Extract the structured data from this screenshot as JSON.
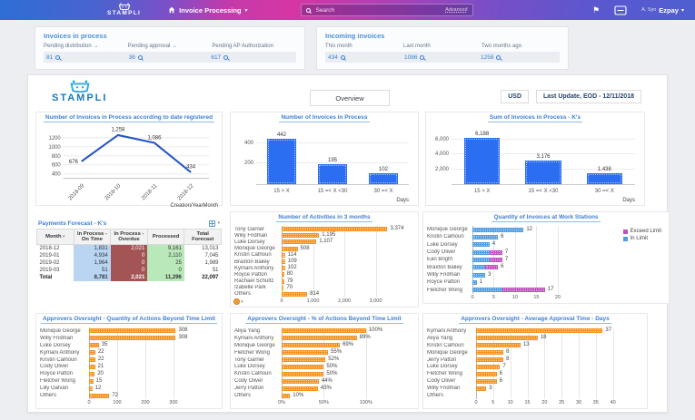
{
  "topbar": {
    "brand": "STAMPLI",
    "nav": {
      "label": "Invoice Processing"
    },
    "search": {
      "placeholder": "Search",
      "advanced": "Advanced"
    },
    "user": {
      "prefix": "A. Syn",
      "name": "Ezpay"
    }
  },
  "summary_cards": [
    {
      "title": "Invoices in process",
      "stats": [
        {
          "label": "Pending distribution →",
          "value": "81"
        },
        {
          "label": "Pending approval →",
          "value": "36"
        },
        {
          "label": "Pending AP Authorization",
          "value": "617"
        }
      ]
    },
    {
      "title": "Incoming invoices",
      "stats": [
        {
          "label": "This month",
          "value": "434"
        },
        {
          "label": "Last month",
          "value": "1086"
        },
        {
          "label": "Two months ago",
          "value": "1258"
        }
      ]
    }
  ],
  "dashboard": {
    "brand": "STAMPLI",
    "tab": "Overview",
    "currency": "USD",
    "last_update": "Last Update, EOD - 12/11/2018"
  },
  "colors": {
    "bar_blue": "#2b6ef2",
    "bar_orange": "#f5921e",
    "line_blue": "#2456c2",
    "in_limit_blue": "#4e9de2",
    "exceed_magenta": "#c24fc0",
    "title_blue": "#3f80d5",
    "topbar_pink": "#d636a4",
    "topbar_blue": "#2e6ed5"
  },
  "chart_data": [
    {
      "type": "line",
      "title": "Number of Invoices in Process according to date registered",
      "x": [
        "2018-09",
        "2018-10",
        "2018-11",
        "2018-12"
      ],
      "values": [
        676,
        1258,
        1086,
        434
      ],
      "labels": [
        "676",
        "1,258",
        "1,086",
        "434"
      ],
      "xlabel": "Creation/YearMonth",
      "yticks": [
        400,
        600,
        800,
        1000,
        1200
      ],
      "ylim": [
        300,
        1350
      ],
      "color": "#2456c2"
    },
    {
      "type": "bar",
      "title": "Number of Invoices in Process",
      "categories": [
        "15 > X",
        "15 =< X <30",
        "30 =< X"
      ],
      "values": [
        442,
        195,
        102
      ],
      "labels": [
        "442",
        "195",
        "102"
      ],
      "xlabel": "Days",
      "yticks": [
        200,
        400
      ],
      "ytick_labels": [
        "200",
        "400"
      ],
      "ylim": [
        0,
        520
      ],
      "color": "#2b6ef2"
    },
    {
      "type": "bar",
      "title": "Sum of Invoices in Process - K's",
      "categories": [
        "15 > X",
        "15 =< X <30",
        "30 =< X"
      ],
      "values": [
        6188,
        3176,
        1438
      ],
      "labels": [
        "6,188",
        "3,176",
        "1,438"
      ],
      "xlabel": "Days",
      "yticks": [
        2000,
        4000,
        6000
      ],
      "ytick_labels": [
        "2,000",
        "4,000",
        "6,000"
      ],
      "ylim": [
        0,
        7200
      ],
      "color": "#2b6ef2"
    },
    {
      "type": "table",
      "title": "Payments Forecast - K's",
      "columns": [
        "Month",
        "In Process - On Time",
        "In Process - Overdue",
        "Processed",
        "Total Forecast"
      ],
      "rows": [
        [
          "2018-12",
          "1,831",
          "2,021",
          "9,161",
          "13,013"
        ],
        [
          "2019-01",
          "4,934",
          "0",
          "2,110",
          "7,045"
        ],
        [
          "2019-02",
          "1,964",
          "0",
          "25",
          "1,989"
        ],
        [
          "2019-03",
          "51",
          "0",
          "0",
          "51"
        ],
        [
          "Total",
          "8,781",
          "2,021",
          "11,296",
          "22,097"
        ]
      ],
      "column_colors": [
        "",
        "#b9d5f2",
        "#a35555",
        "#b9e8ba",
        ""
      ],
      "column_text": [
        "",
        "#333",
        "#fff",
        "#333",
        ""
      ]
    },
    {
      "type": "hbar",
      "title": "Number of Activities in 3 months",
      "categories": [
        "Tony Garner",
        "Willy Fridman",
        "Luke Dorsey",
        "Monique George",
        "Kristin Calhoun",
        "Braxton Bailey",
        "Kymani Anthony",
        "Royce Patton",
        "Rachael Schultz",
        "Izabelle Park",
        "Others"
      ],
      "values": [
        3374,
        1195,
        1107,
        508,
        114,
        109,
        102,
        80,
        79,
        70,
        814
      ],
      "labels": [
        "3,374",
        "1,195",
        "1,107",
        "508",
        "114",
        "109",
        "102",
        "80",
        "79",
        "70",
        "814"
      ],
      "xticks": [
        0,
        1000,
        2000,
        3000
      ],
      "xtick_labels": [
        "0",
        "1,000",
        "2,000",
        "3,000"
      ],
      "xlim": [
        0,
        3650
      ],
      "label_w": 56,
      "rpad": 24,
      "color": "#f5921e"
    },
    {
      "type": "hbar-stacked",
      "title": "Quantity of Invoices at Work Stations",
      "categories": [
        "Monique George",
        "Kristin Calhoun",
        "Luke Dorsey",
        "Cody Oliver",
        "Ean Bright",
        "Braxton Bailey",
        "Willy Fridman",
        "Royce Patton",
        "Fletcher Wong"
      ],
      "series": [
        {
          "name": "In Limit",
          "color": "#4e9de2",
          "values": [
            12,
            6,
            4,
            4,
            4,
            3,
            3,
            1,
            7
          ]
        },
        {
          "name": "Exceed Limit",
          "color": "#c24fc0",
          "values": [
            0,
            0,
            0,
            3,
            3,
            3,
            0,
            0,
            10
          ]
        }
      ],
      "totals": [
        "12",
        "6",
        "4",
        "7",
        "7",
        "6",
        "3",
        "1",
        "17"
      ],
      "legend": [
        "Exceed Limit",
        "In Limit"
      ],
      "legend_colors": [
        "#c24fc0",
        "#4e9de2"
      ],
      "legend_pos": "top-right",
      "xticks": [
        0,
        5,
        10,
        15,
        20
      ],
      "xtick_labels": [
        "0",
        "5",
        "10",
        "15",
        "20"
      ],
      "xlim": [
        0,
        23
      ],
      "label_w": 54,
      "rpad": 108
    },
    {
      "type": "hbar",
      "title": "Approvers Oversight - Quantity of Actions Beyond Time Limit",
      "categories": [
        "Monique George",
        "Willy Fridman",
        "Luke Dorsey",
        "Kymani Anthony",
        "Kristin Calhoun",
        "Cody Oliver",
        "Royce Patton",
        "Fletcher Wong",
        "Lilly Galvan",
        "Others"
      ],
      "values": [
        308,
        308,
        35,
        22,
        22,
        21,
        20,
        15,
        12,
        72
      ],
      "labels": [
        "308",
        "308",
        "35",
        "22",
        "22",
        "21",
        "20",
        "15",
        "12",
        "72"
      ],
      "xticks": [
        0,
        100,
        200,
        300
      ],
      "xtick_labels": [
        "0",
        "100",
        "200",
        "300"
      ],
      "xlim": [
        0,
        400
      ],
      "label_w": 58,
      "rpad": 22,
      "color": "#f5921e"
    },
    {
      "type": "hbar",
      "title": "Approvers Oversight - % of Actions Beyond Time Limit",
      "categories": [
        "Aliya Yang",
        "Kymani Anthony",
        "Monique George",
        "Fletcher Wong",
        "Tony Garner",
        "Luke Dorsey",
        "Kristin Calhoun",
        "Cody Oliver",
        "Jerry Patton",
        "Others"
      ],
      "values": [
        100,
        89,
        69,
        55,
        52,
        50,
        50,
        44,
        43,
        10
      ],
      "labels": [
        "100%",
        "89%",
        "69%",
        "55%",
        "52%",
        "50%",
        "50%",
        "44%",
        "43%",
        "10%"
      ],
      "xticks": [
        0,
        50,
        100
      ],
      "xtick_labels": [
        "0%",
        "50%",
        "100%"
      ],
      "xlim": [
        0,
        140
      ],
      "label_w": 56,
      "rpad": 20,
      "color": "#f5921e"
    },
    {
      "type": "hbar",
      "title": "Approvers Oversight - Average Approval Time - Days",
      "categories": [
        "Kymani Anthony",
        "Aliya Yang",
        "Kristin Calhoun",
        "Monique George",
        "Jerry Patton",
        "Luke Dorsey",
        "Fletcher Wong",
        "Cody Oliver",
        "Willy Fridman",
        "Others"
      ],
      "values": [
        37,
        18,
        13,
        8,
        8,
        7,
        6,
        6,
        3,
        0
      ],
      "labels": [
        "37",
        "18",
        "13",
        "8",
        "8",
        "7",
        "6",
        "6",
        "3",
        ""
      ],
      "xticks": [
        0,
        5,
        10,
        15,
        20,
        25,
        30,
        35,
        40
      ],
      "xtick_labels": [
        "0",
        "5",
        "10",
        "15",
        "20",
        "25",
        "30",
        "35",
        "40"
      ],
      "xlim": [
        0,
        43
      ],
      "label_w": 58,
      "rpad": 26,
      "color": "#f5921e"
    }
  ]
}
